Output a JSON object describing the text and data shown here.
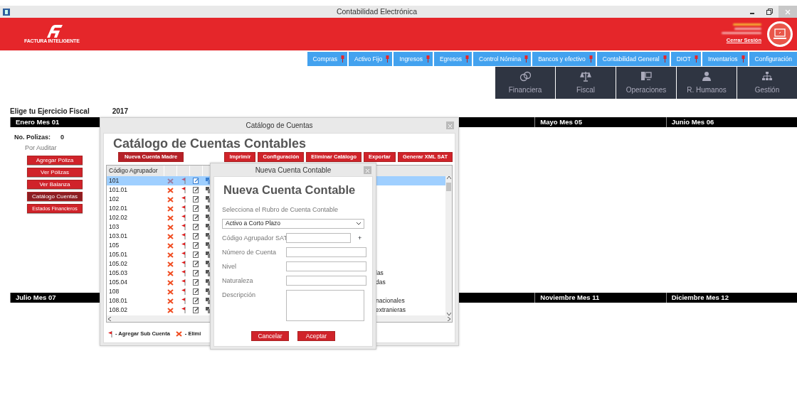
{
  "window": {
    "title": "Contabilidad Electrónica"
  },
  "header": {
    "logo_text": "FACTURA INTELIGENTE",
    "logout": "Cerrar Sesión"
  },
  "menu": [
    {
      "label": "Compras",
      "pin": true
    },
    {
      "label": "Activo Fijo",
      "pin": true
    },
    {
      "label": "Ingresos",
      "pin": true
    },
    {
      "label": "Egresos",
      "pin": true
    },
    {
      "label": "Control Nómina",
      "pin": true
    },
    {
      "label": "Bancos y efectivo",
      "pin": true
    },
    {
      "label": "Contabilidad General",
      "pin": true
    },
    {
      "label": "DIOT",
      "pin": true
    },
    {
      "label": "Inventarios",
      "pin": true
    },
    {
      "label": "Configuración",
      "pin": false
    }
  ],
  "modules": [
    {
      "label": "Financiera",
      "kind": "coins"
    },
    {
      "label": "Fiscal",
      "kind": "scale"
    },
    {
      "label": "Operaciones",
      "kind": "computer"
    },
    {
      "label": "R. Humanos",
      "kind": "person"
    },
    {
      "label": "Gestión",
      "kind": "org"
    }
  ],
  "fiscal_year": {
    "label": "Elige tu Ejercicio Fiscal",
    "value": "2017"
  },
  "month_rows": [
    {
      "first": {
        "title": "Enero Mes 01",
        "polizas_label": "No. Polizas:",
        "polizas_count": "0",
        "status": "Por Auditar",
        "actions": [
          {
            "label": "Agregar Póliza",
            "kind": "normal",
            "selected": false
          },
          {
            "label": "Ver Pólizas",
            "kind": "normal",
            "selected": false
          },
          {
            "label": "Ver Balanza",
            "kind": "normal",
            "selected": false
          },
          {
            "label": "Catálogo Cuentas",
            "kind": "normal",
            "selected": true
          },
          {
            "label": "Estados Financieros",
            "kind": "small",
            "selected": false
          }
        ]
      },
      "last": [
        {
          "title": "Mayo Mes 05"
        },
        {
          "title": "Junio Mes 06"
        }
      ]
    },
    {
      "first": {
        "title": "Julio Mes 07"
      },
      "last": [
        {
          "title": "Noviembre Mes 11"
        },
        {
          "title": "Diciembre Mes 12"
        }
      ]
    }
  ],
  "catalog": {
    "title": "Catálogo de Cuentas",
    "heading": "Catálogo de Cuentas Contables",
    "new_button": "Nueva Cuenta Madre",
    "toolbar": [
      "Imprimir",
      "Configuración",
      "Eliminar Catálogo",
      "Exportar",
      "Generar XML SAT"
    ],
    "columns": [
      "Código Agrupador"
    ],
    "rows": [
      {
        "code": "101",
        "selected": true
      },
      {
        "code": "101.01",
        "selected": false
      },
      {
        "code": "102",
        "selected": false
      },
      {
        "code": "102.01",
        "selected": false
      },
      {
        "code": "102.02",
        "selected": false
      },
      {
        "code": "103",
        "selected": false
      },
      {
        "code": "103.01",
        "selected": false
      },
      {
        "code": "105",
        "selected": false
      },
      {
        "code": "105.01",
        "selected": false
      },
      {
        "code": "105.02",
        "selected": false
      },
      {
        "code": "105.03",
        "description": "las",
        "selected": false
      },
      {
        "code": "105.04",
        "description": "das",
        "selected": false
      },
      {
        "code": "108",
        "selected": false
      },
      {
        "code": "108.01",
        "description": "nacionales",
        "selected": false
      },
      {
        "code": "108.02",
        "description": "extranieras",
        "selected": false
      }
    ],
    "legend": [
      {
        "kind": "flag",
        "label": "- Agregar Sub Cuenta"
      },
      {
        "kind": "delete",
        "label": "- Elimi"
      }
    ]
  },
  "dialog": {
    "title": "Nueva Cuenta Contable",
    "heading": "Nueva Cuenta Contable",
    "rubro_label": "Selecciona el Rubro de Cuenta Contable",
    "rubro_value": "Activo a Corto Plazo",
    "fields": [
      {
        "label": "Código Agrupador SAT",
        "kind": "code",
        "extra": "+"
      },
      {
        "label": "Número de Cuenta",
        "kind": "text"
      },
      {
        "label": "Nivel",
        "kind": "text"
      },
      {
        "label": "Naturaleza",
        "kind": "text"
      },
      {
        "label": "Descripción",
        "kind": "textarea"
      }
    ],
    "buttons": [
      "Cancelar",
      "Aceptar"
    ]
  }
}
